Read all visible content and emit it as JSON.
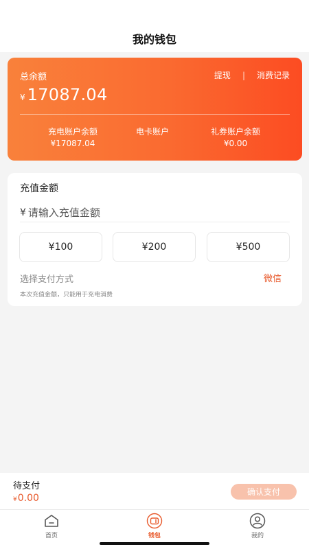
{
  "header": {
    "title": "我的钱包"
  },
  "balance": {
    "label": "总余额",
    "currency": "¥",
    "amount": "17087.04",
    "withdraw_label": "提现",
    "separator": "|",
    "records_label": "消费记录",
    "accounts": [
      {
        "label": "充电账户余额",
        "value": "¥17087.04"
      },
      {
        "label": "电卡账户",
        "value": ""
      },
      {
        "label": "礼券账户余额",
        "value": "¥0.00"
      }
    ]
  },
  "recharge": {
    "title": "充值金额",
    "currency": "¥",
    "placeholder": "请输入充值金额",
    "options": [
      "¥100",
      "¥200",
      "¥500"
    ],
    "pay_method_label": "选择支付方式",
    "pay_method_value": "微信",
    "note": "本次充值金额，只能用于充电消费"
  },
  "pay_bar": {
    "label": "待支付",
    "currency": "¥",
    "amount": "0.00",
    "confirm_label": "确认支付"
  },
  "tabbar": {
    "items": [
      {
        "label": "首页",
        "icon": "home-icon"
      },
      {
        "label": "钱包",
        "icon": "wallet-icon",
        "active": true
      },
      {
        "label": "我的",
        "icon": "user-icon"
      }
    ]
  },
  "colors": {
    "accent": "#e8592b",
    "card_gradient_start": "#f9813b",
    "card_gradient_end": "#fc4c22",
    "confirm_disabled": "#f8c2ac"
  }
}
